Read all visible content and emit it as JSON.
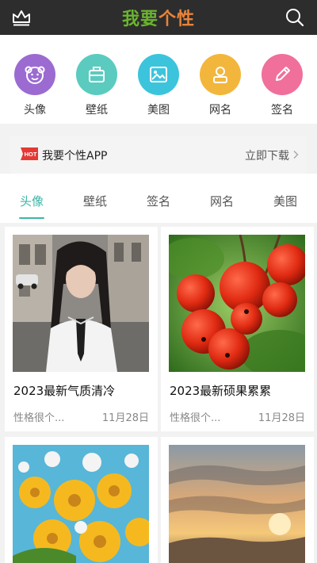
{
  "header": {
    "logo_part1": "我要",
    "logo_part2": "个性",
    "colors": {
      "bar": "#2d2d2d",
      "green": "#6ab42f",
      "orange": "#e8833a"
    }
  },
  "categories": [
    {
      "label": "头像",
      "icon": "baby-face-icon",
      "color": "#9b6bd1"
    },
    {
      "label": "壁纸",
      "icon": "wallpaper-icon",
      "color": "#5bcbbf"
    },
    {
      "label": "美图",
      "icon": "image-icon",
      "color": "#3cc4dc"
    },
    {
      "label": "网名",
      "icon": "user-icon",
      "color": "#f3b63c"
    },
    {
      "label": "签名",
      "icon": "pencil-icon",
      "color": "#f0709b"
    }
  ],
  "banner": {
    "badge": "HOT",
    "title": "我要个性APP",
    "action": "立即下载"
  },
  "tabs": [
    "头像",
    "壁纸",
    "签名",
    "网名",
    "美图"
  ],
  "active_tab": "头像",
  "accent_color": "#3cb7a6",
  "cards": [
    {
      "title": "2023最新气质清冷",
      "excerpt": "性格很个...",
      "date": "11月28日",
      "image": "portrait-photo"
    },
    {
      "title": "2023最新硕果累累",
      "excerpt": "性格很个...",
      "date": "11月28日",
      "image": "red-berries-photo"
    },
    {
      "title": "",
      "excerpt": "",
      "date": "",
      "image": "yellow-flowers-photo"
    },
    {
      "title": "",
      "excerpt": "",
      "date": "",
      "image": "sunset-photo"
    }
  ]
}
